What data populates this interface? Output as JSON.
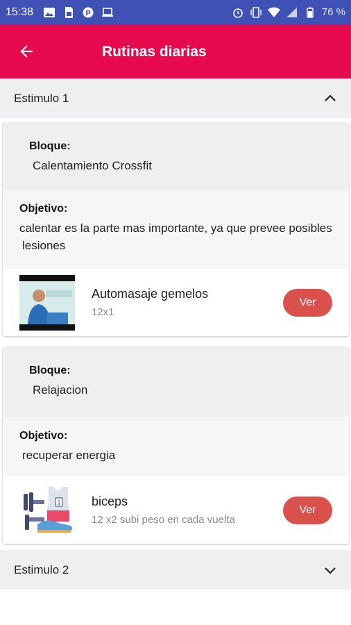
{
  "status_bar": {
    "time": "15:38",
    "battery": "76 %",
    "left_icons": [
      "image-icon",
      "sim-card-icon",
      "parking-icon",
      "laptop-icon"
    ],
    "right_icons": [
      "alarm-icon",
      "vibrate-icon",
      "wifi-icon",
      "signal-icon",
      "battery-icon"
    ]
  },
  "app_bar": {
    "title": "Rutinas diarias",
    "background": "#e6094d"
  },
  "sections": [
    {
      "title": "Estimulo 1",
      "expanded": true,
      "blocks": [
        {
          "bloque_label": "Bloque:",
          "bloque_value": "Calentamiento Crossfit",
          "objetivo_label": "Objetivo:",
          "objetivo_value": "calentar es la parte mas importante, ya que prevee posibles lesiones",
          "exercise": {
            "name": "Automasaje gemelos",
            "detail": "12x1",
            "button": "Ver"
          }
        },
        {
          "bloque_label": "Bloque:",
          "bloque_value": "Relajacion",
          "objetivo_label": "Objetivo:",
          "objetivo_value": "recuperar energia",
          "exercise": {
            "name": "biceps",
            "detail": "12 x2 subi peso en cada vuelta",
            "button": "Ver"
          }
        }
      ]
    },
    {
      "title": "Estimulo 2",
      "expanded": false
    }
  ],
  "colors": {
    "status_bar": "#3f51b5",
    "button": "#d9514a",
    "section_bg": "#efeff1"
  }
}
